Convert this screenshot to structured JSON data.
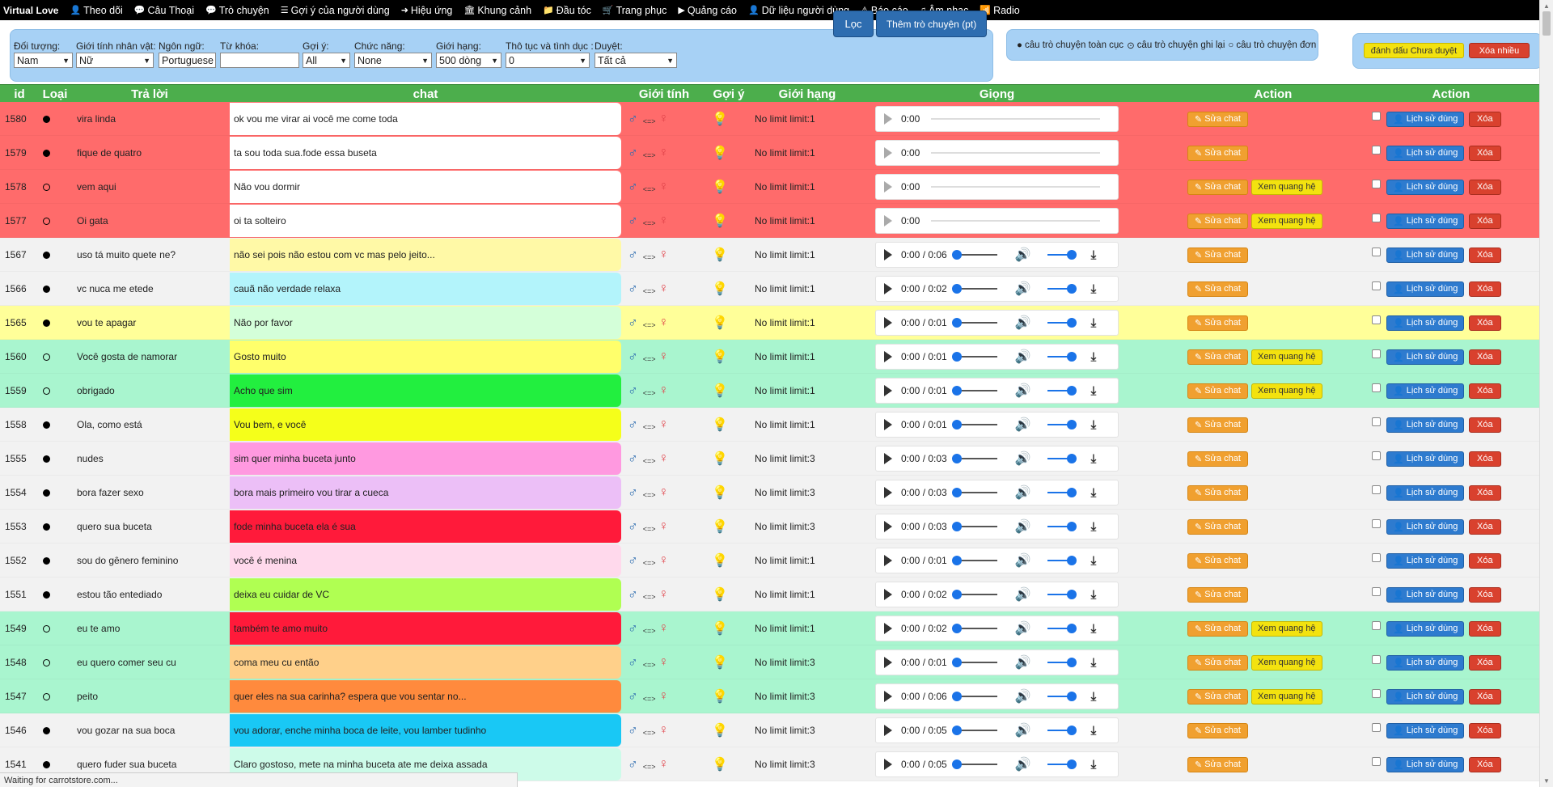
{
  "nav": {
    "brand": "Virtual Love",
    "items": [
      {
        "icon": "user-icon",
        "glyph": "👤",
        "label": "Theo dõi"
      },
      {
        "icon": "comment-icon",
        "glyph": "💬",
        "label": "Câu Thoại"
      },
      {
        "icon": "comments-icon",
        "glyph": "💬",
        "label": "Trò chuyện"
      },
      {
        "icon": "list-icon",
        "glyph": "☰",
        "label": "Gợi ý của người dùng"
      },
      {
        "icon": "circle-arrow-icon",
        "glyph": "➜",
        "label": "Hiệu ứng"
      },
      {
        "icon": "bank-icon",
        "glyph": "🏛",
        "label": "Khung cảnh"
      },
      {
        "icon": "folder-icon",
        "glyph": "📁",
        "label": "Đầu tóc"
      },
      {
        "icon": "cart-icon",
        "glyph": "🛒",
        "label": "Trang phục"
      },
      {
        "icon": "play-circle-icon",
        "glyph": "▶",
        "label": "Quảng cáo"
      },
      {
        "icon": "user-outline-icon",
        "glyph": "👤",
        "label": "Dữ liệu người dùng"
      },
      {
        "icon": "warning-icon",
        "glyph": "⚠",
        "label": "Báo cáo"
      },
      {
        "icon": "music-icon",
        "glyph": "♫",
        "label": "Âm nhạc"
      },
      {
        "icon": "wifi-icon",
        "glyph": "📶",
        "label": "Radio"
      }
    ]
  },
  "filters": {
    "doi_tuong": {
      "label": "Đối tượng:",
      "value": "Nam"
    },
    "gioi_tinh": {
      "label": "Giới tính nhân vật:",
      "value": "Nữ"
    },
    "ngon_ngu": {
      "label": "Ngôn ngữ:",
      "value": "Portuguese"
    },
    "tu_khoa": {
      "label": "Từ khóa:",
      "value": ""
    },
    "goi_y": {
      "label": "Gợi ý:",
      "value": "All"
    },
    "chuc_nang": {
      "label": "Chức năng:",
      "value": "None"
    },
    "gioi_han": {
      "label": "Giới hạng:",
      "value": "500 dòng"
    },
    "tho_tuc": {
      "label": "Thô tục và tình dục :",
      "value": "0"
    },
    "duyet": {
      "label": "Duyệt:",
      "value": "Tất cả"
    },
    "filter_button": "Lọc",
    "add_button": "Thêm trò chuyện (pt)"
  },
  "legend": {
    "global": "câu trò chuyện toàn cục",
    "rerecord": "câu trò chuyện ghi lại",
    "single": "câu trò chuyện đơn"
  },
  "actions": {
    "mark_unapproved": "đánh dấu Chưa duyệt",
    "delete_many": "Xóa nhiều"
  },
  "table": {
    "headers": {
      "id": "id",
      "type": "Loại",
      "reply": "Trả lời",
      "chat": "chat",
      "gender": "Giới tính",
      "hint": "Gợi ý",
      "limit": "Giới hạng",
      "voice": "Giọng",
      "action1": "Action",
      "action2": "Action"
    },
    "button_labels": {
      "edit": "Sửa chat",
      "relation": "Xem quang hệ",
      "history": "Lịch sử dùng",
      "delete": "Xóa"
    },
    "gender_separator": "<=>",
    "rows": [
      {
        "id": "1580",
        "type": "filled",
        "reply": "vira linda",
        "chat": "ok vou me virar ai você me come toda",
        "limit": "No limit limit:1",
        "time": "",
        "relation": false,
        "row_bg": "#ff6b6b",
        "chat_bg": "#ffffff"
      },
      {
        "id": "1579",
        "type": "filled",
        "reply": "fique de quatro",
        "chat": "ta sou toda sua.fode essa buseta",
        "limit": "No limit limit:1",
        "time": "",
        "relation": false,
        "row_bg": "#ff6b6b",
        "chat_bg": "#ffffff"
      },
      {
        "id": "1578",
        "type": "open",
        "reply": "vem aqui",
        "chat": "Não vou dormir",
        "limit": "No limit limit:1",
        "time": "",
        "relation": true,
        "row_bg": "#ff6b6b",
        "chat_bg": "#ffffff"
      },
      {
        "id": "1577",
        "type": "open",
        "reply": "Oi gata",
        "chat": "oi ta solteiro",
        "limit": "No limit limit:1",
        "time": "",
        "relation": true,
        "row_bg": "#ff6b6b",
        "chat_bg": "#ffffff"
      },
      {
        "id": "1567",
        "type": "filled",
        "reply": "uso tá muito quete ne?",
        "chat": "não sei pois não estou com vc mas pelo jeito...",
        "limit": "No limit limit:1",
        "time": "0:00 / 0:06",
        "relation": false,
        "row_bg": "#f2f2f2",
        "chat_bg": "#fff9a6"
      },
      {
        "id": "1566",
        "type": "filled",
        "reply": "vc nuca me etede",
        "chat": "cauã não verdade relaxa",
        "limit": "No limit limit:1",
        "time": "0:00 / 0:02",
        "relation": false,
        "row_bg": "#f2f2f2",
        "chat_bg": "#b3f4fb"
      },
      {
        "id": "1565",
        "type": "filled",
        "reply": "vou te apagar",
        "chat": "Não por favor",
        "limit": "No limit limit:1",
        "time": "0:00 / 0:01",
        "relation": false,
        "row_bg": "#ffff99",
        "chat_bg": "#d4ffd9"
      },
      {
        "id": "1560",
        "type": "open",
        "reply": "Você gosta de namorar",
        "chat": "Gosto muito",
        "limit": "No limit limit:1",
        "time": "0:00 / 0:01",
        "relation": true,
        "row_bg": "#a9f5cf",
        "chat_bg": "#ffff6b"
      },
      {
        "id": "1559",
        "type": "open",
        "reply": "obrigado",
        "chat": "Acho que sim",
        "limit": "No limit limit:1",
        "time": "0:00 / 0:01",
        "relation": true,
        "row_bg": "#a9f5cf",
        "chat_bg": "#22ef3f"
      },
      {
        "id": "1558",
        "type": "filled",
        "reply": "Ola, como está",
        "chat": "Vou bem, e você",
        "limit": "No limit limit:1",
        "time": "0:00 / 0:01",
        "relation": false,
        "row_bg": "#f2f2f2",
        "chat_bg": "#f5ff1a"
      },
      {
        "id": "1555",
        "type": "filled",
        "reply": "nudes",
        "chat": "sim quer minha buceta junto",
        "limit": "No limit limit:3",
        "time": "0:00 / 0:03",
        "relation": false,
        "row_bg": "#f2f2f2",
        "chat_bg": "#ff99e0"
      },
      {
        "id": "1554",
        "type": "filled",
        "reply": "bora fazer sexo",
        "chat": "bora mais primeiro vou tirar a cueca",
        "limit": "No limit limit:3",
        "time": "0:00 / 0:03",
        "relation": false,
        "row_bg": "#f2f2f2",
        "chat_bg": "#ecbff7"
      },
      {
        "id": "1553",
        "type": "filled",
        "reply": "quero sua buceta",
        "chat": "fode minha buceta ela é sua",
        "limit": "No limit limit:3",
        "time": "0:00 / 0:03",
        "relation": false,
        "row_bg": "#f2f2f2",
        "chat_bg": "#ff1a3a"
      },
      {
        "id": "1552",
        "type": "filled",
        "reply": "sou do gênero feminino",
        "chat": "você é menina",
        "limit": "No limit limit:1",
        "time": "0:00 / 0:01",
        "relation": false,
        "row_bg": "#f2f2f2",
        "chat_bg": "#ffd9ec"
      },
      {
        "id": "1551",
        "type": "filled",
        "reply": "estou tão entediado",
        "chat": "deixa eu cuidar de VC",
        "limit": "No limit limit:1",
        "time": "0:00 / 0:02",
        "relation": false,
        "row_bg": "#f2f2f2",
        "chat_bg": "#b0ff52"
      },
      {
        "id": "1549",
        "type": "open",
        "reply": "eu te amo",
        "chat": "também te amo muito",
        "limit": "No limit limit:1",
        "time": "0:00 / 0:02",
        "relation": true,
        "row_bg": "#a9f5cf",
        "chat_bg": "#ff1a3a"
      },
      {
        "id": "1548",
        "type": "open",
        "reply": "eu quero comer seu cu",
        "chat": "coma meu cu então",
        "limit": "No limit limit:3",
        "time": "0:00 / 0:01",
        "relation": true,
        "row_bg": "#a9f5cf",
        "chat_bg": "#ffd08a"
      },
      {
        "id": "1547",
        "type": "open",
        "reply": "peito",
        "chat": "quer eles na sua carinha? espera que vou sentar no...",
        "limit": "No limit limit:3",
        "time": "0:00 / 0:06",
        "relation": true,
        "row_bg": "#a9f5cf",
        "chat_bg": "#ff8a3d"
      },
      {
        "id": "1546",
        "type": "filled",
        "reply": "vou gozar na sua boca",
        "chat": "vou adorar, enche minha boca de leite, vou lamber tudinho",
        "limit": "No limit limit:3",
        "time": "0:00 / 0:05",
        "relation": false,
        "row_bg": "#f2f2f2",
        "chat_bg": "#19c8f5"
      },
      {
        "id": "1541",
        "type": "filled",
        "reply": "quero fuder sua buceta",
        "chat": "Claro gostoso, mete na minha buceta ate me deixa assada",
        "limit": "No limit limit:3",
        "time": "0:00 / 0:05",
        "relation": false,
        "row_bg": "#f2f2f2",
        "chat_bg": "#cdfbe9"
      }
    ]
  },
  "empty_voice_time": "0:00",
  "status": "Waiting for carrotstore.com..."
}
